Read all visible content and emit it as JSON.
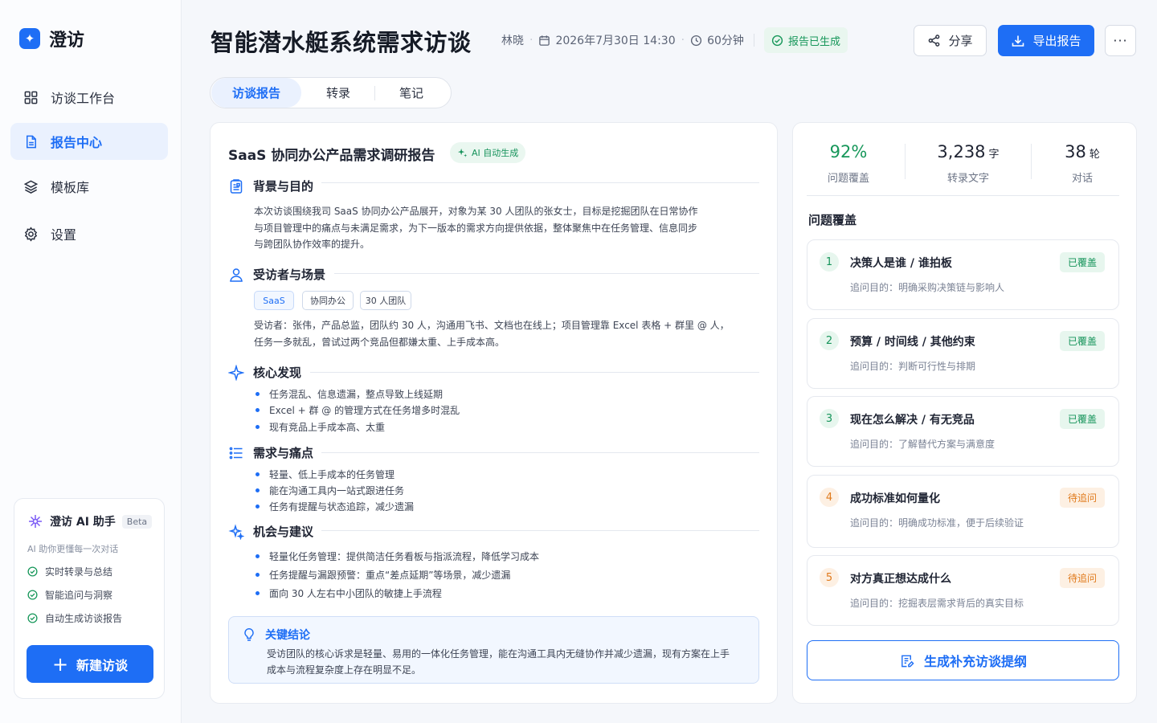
{
  "app": {
    "name": "澄访"
  },
  "nav": {
    "items": [
      {
        "label": "访谈工作台",
        "icon": "grid-icon"
      },
      {
        "label": "报告中心",
        "icon": "document-icon",
        "active": true
      },
      {
        "label": "模板库",
        "icon": "layers-icon"
      },
      {
        "label": "设置",
        "icon": "gear-icon"
      }
    ]
  },
  "assistant": {
    "title": "澄访 AI 助手",
    "badge": "Beta",
    "desc": "AI 助你更懂每一次对话",
    "features": [
      "实时转录与总结",
      "智能追问与洞察",
      "自动生成访谈报告"
    ],
    "new_button": "新建访谈"
  },
  "header": {
    "title": "智能潜水艇系统需求访谈",
    "interviewer": "林晓",
    "datetime": "2026年7月30日 14:30",
    "duration": "60分钟",
    "status": "报告已生成",
    "share": "分享",
    "export": "导出报告",
    "more": "···"
  },
  "tabs": [
    {
      "label": "访谈报告",
      "active": true
    },
    {
      "label": "转录"
    },
    {
      "label": "笔记"
    }
  ],
  "report": {
    "title": "SaaS 协同办公产品需求调研报告",
    "ai_tag": "AI 自动生成",
    "sections": {
      "background": {
        "title": "背景与目的",
        "lines": [
          "本次访谈围绕我司 SaaS 协同办公产品展开，对象为某 30 人团队的张女士，目标是挖掘团队在日常协作",
          "与项目管理中的痛点与未满足需求，为下一版本的需求方向提供依据，整体聚焦中在任务管理、信息同步",
          "与跨团队协作效率的提升。"
        ]
      },
      "interviewee": {
        "title": "受访者与场景",
        "tags": [
          "SaaS",
          "协同办公",
          "30 人团队"
        ],
        "lines": [
          "受访者：张伟，产品总监，团队约 30 人，沟通用飞书、文档也在线上；项目管理靠 Excel 表格 + 群里 @ 人，",
          "任务一多就乱，曾试过两个竞品但都嫌太重、上手成本高。"
        ]
      },
      "findings": {
        "title": "核心发现",
        "bullets": [
          "任务混乱、信息遗漏，整点导致上线延期",
          "Excel + 群 @ 的管理方式在任务增多时混乱",
          "现有竞品上手成本高、太重"
        ]
      },
      "needs": {
        "title": "需求与痛点",
        "bullets": [
          "轻量、低上手成本的任务管理",
          "能在沟通工具内一站式跟进任务",
          "任务有提醒与状态追踪，减少遗漏"
        ]
      },
      "opportunities": {
        "title": "机会与建议",
        "bullets": [
          "轻量化任务管理：提供简洁任务看板与指派流程，降低学习成本",
          "任务提醒与漏跟预警：重点“差点延期”等场景，减少遗漏",
          "面向 30 人左右中小团队的敏捷上手流程"
        ]
      },
      "conclusion": {
        "title": "关键结论",
        "lines": [
          "受访团队的核心诉求是轻量、易用的一体化任务管理，能在沟通工具内无缝协作并减少遗漏，现有方案在上手",
          "成本与流程复杂度上存在明显不足。"
        ]
      }
    }
  },
  "stats": [
    {
      "value": "92%",
      "unit": "",
      "label": "问题覆盖",
      "color": "#17975a"
    },
    {
      "value": "3,238",
      "unit": "字",
      "label": "转录文字",
      "color": "#1f2433"
    },
    {
      "value": "38",
      "unit": "轮",
      "label": "对话",
      "color": "#1f2433"
    }
  ],
  "coverage": {
    "title": "问题覆盖",
    "items": [
      {
        "num": "1",
        "title": "决策人是谁 / 谁拍板",
        "sub": "追问目的：明确采购决策链与影响人",
        "status": "已覆盖",
        "state": "ok"
      },
      {
        "num": "2",
        "title": "预算 / 时间线 / 其他约束",
        "sub": "追问目的：判断可行性与排期",
        "status": "已覆盖",
        "state": "ok"
      },
      {
        "num": "3",
        "title": "现在怎么解决 / 有无竞品",
        "sub": "追问目的：了解替代方案与满意度",
        "status": "已覆盖",
        "state": "ok"
      },
      {
        "num": "4",
        "title": "成功标准如何量化",
        "sub": "追问目的：明确成功标准，便于后续验证",
        "status": "待追问",
        "state": "pend"
      },
      {
        "num": "5",
        "title": "对方真正想达成什么",
        "sub": "追问目的：挖掘表层需求背后的真实目标",
        "status": "待追问",
        "state": "pend"
      }
    ],
    "generate_button": "生成补充访谈提纲"
  },
  "colors": {
    "accent": "#1e6ef5",
    "success": "#17975a",
    "warning": "#e07a1c"
  }
}
